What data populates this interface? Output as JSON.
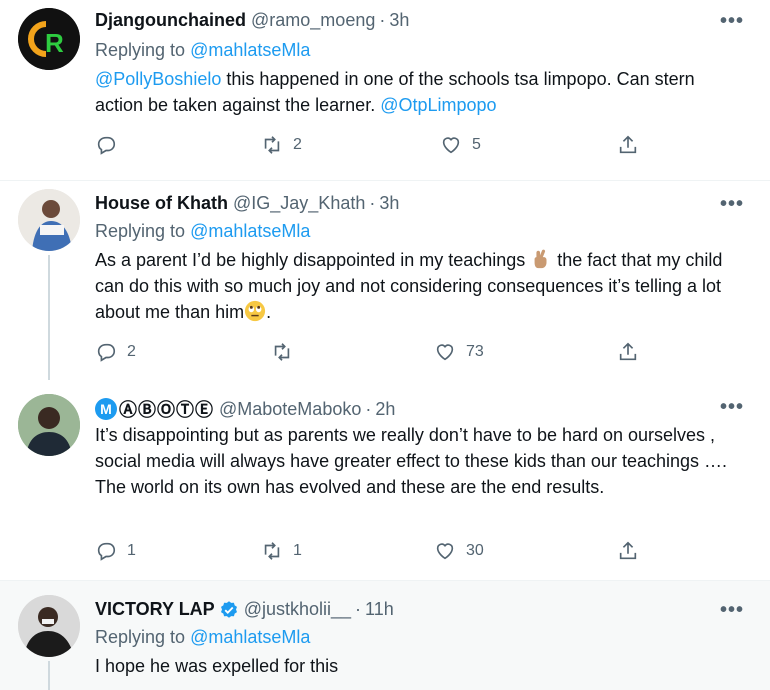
{
  "tweets": [
    {
      "name": "Djangounchained",
      "handle": "@ramo_moeng",
      "dot": "·",
      "time": "3h",
      "more": "•••",
      "replying_prefix": "Replying to ",
      "replying_to": "@mahlatseMla",
      "text_mention1": "@PollyBoshielo",
      "text_part1": " this happened in one of the schools tsa limpopo.  Can stern action be taken against the learner.  ",
      "text_mention2": "@OtpLimpopo",
      "replies": "",
      "retweets": "2",
      "likes": "5"
    },
    {
      "name": "House of Khath",
      "handle": "@IG_Jay_Khath",
      "dot": "·",
      "time": "3h",
      "more": "•••",
      "replying_prefix": "Replying to ",
      "replying_to": "@mahlatseMla",
      "text_part1": "As a parent I’d be highly disappointed in my teachings ",
      "text_part2": " the fact that my child can do this with so much joy and not considering consequences it’s telling a lot about me than him",
      "text_part3": ".",
      "replies": "2",
      "retweets": "",
      "likes": "73"
    },
    {
      "name_badge": "M",
      "name": "ⒶⒷⓄⓉⒺ",
      "handle": "@MaboteMaboko",
      "dot": "·",
      "time": "2h",
      "more": "•••",
      "text": "It’s disappointing but as parents we really don’t have to be hard on ourselves , social media will always have greater effect to these kids than our teachings …. The world on its own has evolved and these are the end results.",
      "replies": "1",
      "retweets": "1",
      "likes": "30"
    },
    {
      "name": "VICTORY LAP",
      "handle": "@justkholii__",
      "dot": "·",
      "time": "11h",
      "more": "•••",
      "replying_prefix": "Replying to ",
      "replying_to": "@mahlatseMla",
      "text": "I hope he was expelled for this"
    }
  ],
  "icons": {
    "reply": "reply-icon",
    "retweet": "retweet-icon",
    "like": "heart-icon",
    "share": "share-icon"
  },
  "colors": {
    "accent": "#1d9bf0",
    "muted": "#536471",
    "text": "#0f1419"
  }
}
